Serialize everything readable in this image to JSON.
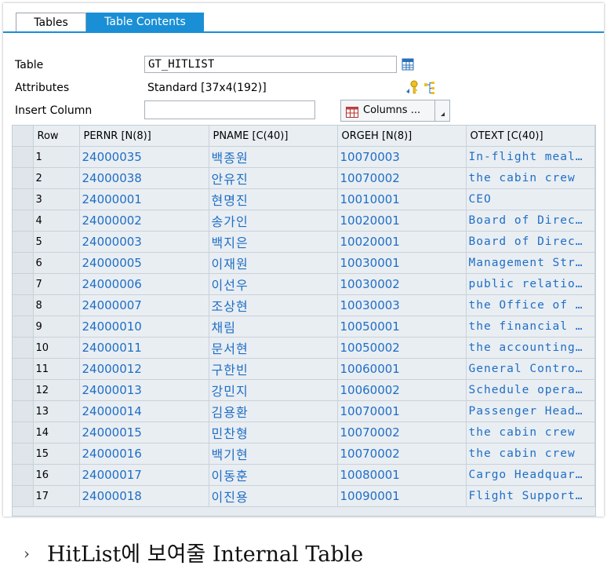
{
  "tabs": [
    {
      "label": "Tables",
      "active": false
    },
    {
      "label": "Table Contents",
      "active": true
    }
  ],
  "colors": {
    "accent": "#1a8fd5",
    "link_text": "#1f6ec4"
  },
  "form": {
    "table_label": "Table",
    "table_value": "GT_HITLIST",
    "attributes_label": "Attributes",
    "attributes_value": "Standard [37x4(192)]",
    "insert_column_label": "Insert Column",
    "insert_column_value": "",
    "columns_button_label": "Columns ..."
  },
  "grid": {
    "headers": [
      "Row",
      "PERNR [N(8)]",
      "PNAME [C(40)]",
      "ORGEH [N(8)]",
      "OTEXT [C(40)]"
    ],
    "rows": [
      [
        "1",
        "24000035",
        "백종원",
        "10070003",
        "In-flight meal…"
      ],
      [
        "2",
        "24000038",
        "안유진",
        "10070002",
        "the cabin crew"
      ],
      [
        "3",
        "24000001",
        "현명진",
        "10010001",
        "CEO"
      ],
      [
        "4",
        "24000002",
        "송가인",
        "10020001",
        "Board of Direc…"
      ],
      [
        "5",
        "24000003",
        "백지은",
        "10020001",
        "Board of Direc…"
      ],
      [
        "6",
        "24000005",
        "이재원",
        "10030001",
        "Management Str…"
      ],
      [
        "7",
        "24000006",
        "이선우",
        "10030002",
        "public relatio…"
      ],
      [
        "8",
        "24000007",
        "조상현",
        "10030003",
        "the Office of …"
      ],
      [
        "9",
        "24000010",
        "채림",
        "10050001",
        "the financial …"
      ],
      [
        "10",
        "24000011",
        "문서현",
        "10050002",
        "the accounting…"
      ],
      [
        "11",
        "24000012",
        "구한빈",
        "10060001",
        "General Contro…"
      ],
      [
        "12",
        "24000013",
        "강민지",
        "10060002",
        "Schedule opera…"
      ],
      [
        "13",
        "24000014",
        "김용환",
        "10070001",
        "Passenger Head…"
      ],
      [
        "14",
        "24000015",
        "민찬형",
        "10070002",
        "the cabin crew"
      ],
      [
        "15",
        "24000016",
        "백기현",
        "10070002",
        "the cabin crew"
      ],
      [
        "16",
        "24000017",
        "이동훈",
        "10080001",
        "Cargo Headquar…"
      ],
      [
        "17",
        "24000018",
        "이진용",
        "10090001",
        "Flight Support…"
      ]
    ]
  },
  "caption": {
    "bullet": "›",
    "text": "HitList에 보여줄 Internal Table"
  }
}
